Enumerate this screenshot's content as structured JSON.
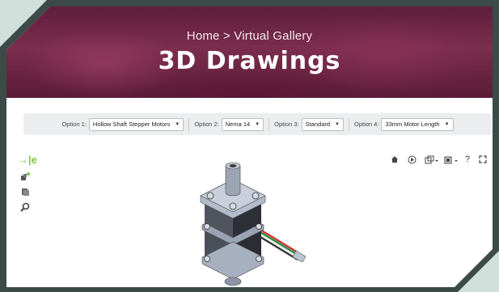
{
  "hero": {
    "breadcrumb": "Home >  Virtual Gallery",
    "title": "3D Drawings"
  },
  "options": [
    {
      "label": "Option 1:",
      "value": "Hollow Shaft Stepper Motors"
    },
    {
      "label": "Option 2:",
      "value": "Nema 14"
    },
    {
      "label": "Option 3:",
      "value": "Standard"
    },
    {
      "label": "Option 4:",
      "value": "33mm Motor Length"
    }
  ],
  "viewer": {
    "logo": "→|e",
    "left_tools": [
      "add-part-icon",
      "views-icon",
      "zoom-search-icon"
    ],
    "right_tools": [
      "home-icon",
      "play-icon",
      "explode-icon",
      "display-mode-icon",
      "help-icon",
      "fullscreen-icon"
    ],
    "help_label": "?"
  },
  "colors": {
    "hero": "#6b2445",
    "logo_green": "#86c347",
    "frame": "#3c4b48"
  }
}
